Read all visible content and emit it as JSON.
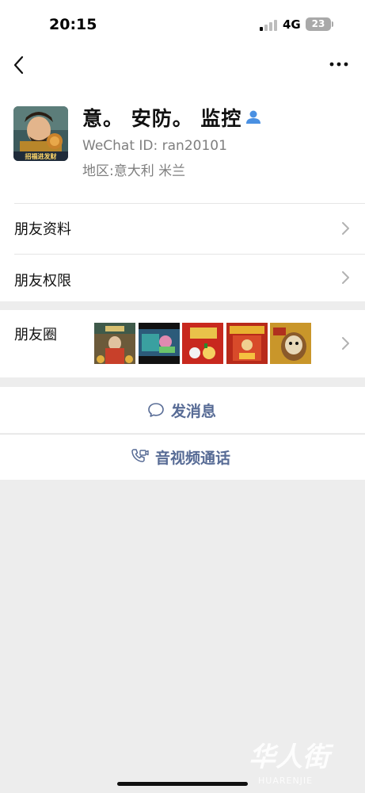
{
  "status_bar": {
    "time": "20:15",
    "network": "4G",
    "battery": "23"
  },
  "nav": {
    "back_icon": "chevron-left-icon",
    "more_icon": "more-dots-icon"
  },
  "profile": {
    "name": "意。 安防。 监控",
    "wechat_id": "WeChat ID: ran20101",
    "region": "地区:意大利 米兰",
    "avatar_caption": "招福进发财",
    "contact_icon": "contact-person-icon"
  },
  "menu": {
    "friend_profile": "朋友资料",
    "friend_permissions": "朋友权限",
    "moments": "朋友圈"
  },
  "actions": {
    "send_message": "发消息",
    "video_call": "音视频通话"
  },
  "colors": {
    "link": "#576b95",
    "background": "#ededed",
    "contact_icon": "#4a90e2"
  },
  "watermark": {
    "brand": "华人街",
    "site": "HUARENJIE"
  }
}
